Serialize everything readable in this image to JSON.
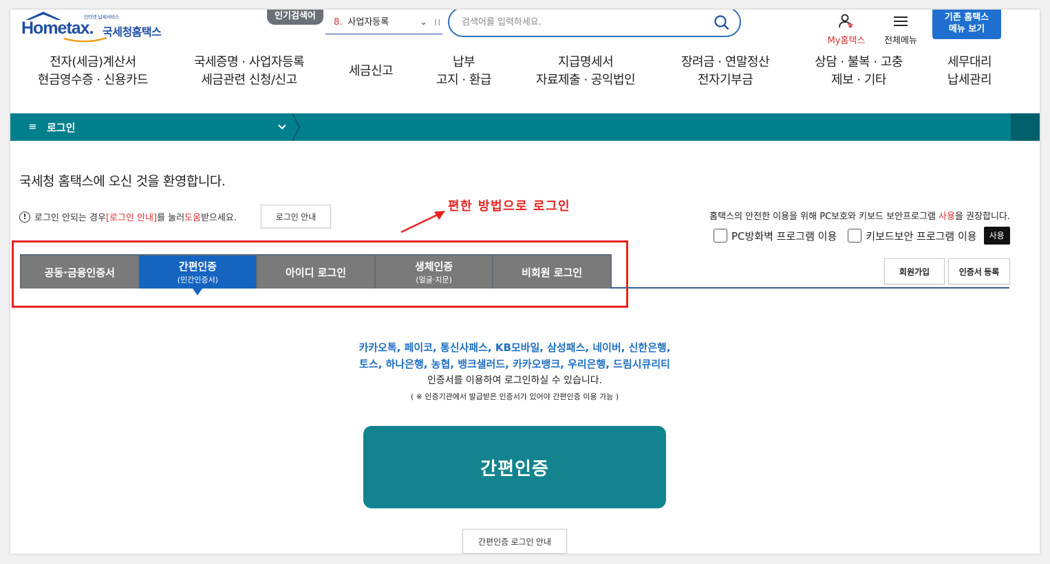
{
  "header": {
    "logo_small": "인터넷 납세서비스",
    "logo_word": "Hometax.",
    "logo_ko": "국세청홈택스",
    "popular_tag": "인기검색어",
    "popular_num": "8.",
    "popular_text": "사업자등록",
    "search_placeholder": "검색어를 입력하세요.",
    "my_hometax": "My홈택스",
    "all_menu": "전체메뉴",
    "old_hometax_line1": "기존 홈택스",
    "old_hometax_line2": "메뉴 보기"
  },
  "gnb": [
    "전자(세금)계산서\n현금영수증 · 신용카드",
    "국세증명 · 사업자등록\n세금관련 신청/신고",
    "세금신고",
    "납부\n고지 · 환급",
    "지급명세서\n자료제출 · 공익법인",
    "장려금 · 연말정산\n전자기부금",
    "상담 · 불복 · 고충\n제보 · 기타",
    "세무대리\n납세관리"
  ],
  "bar": {
    "title": "로그인"
  },
  "welcome": "국세청 홈택스에 오신 것을 환영합니다.",
  "notice": {
    "prefix": "로그인 안되는 경우 ",
    "link": "[로그인 안내]",
    "middle": "를 눌러 ",
    "help": "도움",
    "suffix": "받으세요.",
    "button": "로그인 안내"
  },
  "annotation": "편한 방법으로 로그인",
  "security": {
    "text_prefix": "홈택스의 안전한 이용을 위해 PC보호와 키보드 보안프로그램 ",
    "text_red": "사용",
    "text_suffix": "을 권장합니다.",
    "pc_firewall": "PC방화벽 프로그램 이용",
    "keyboard": "키보드보안 프로그램 이용",
    "use_button": "사용"
  },
  "tabs": [
    {
      "label": "공동·금융인증서",
      "sub": ""
    },
    {
      "label": "간편인증",
      "sub": "(민간인증서)"
    },
    {
      "label": "아이디 로그인",
      "sub": ""
    },
    {
      "label": "생체인증",
      "sub": "(얼굴·지문)"
    },
    {
      "label": "비회원 로그인",
      "sub": ""
    }
  ],
  "buttons": {
    "join": "회원가입",
    "cert_register": "인증서 등록"
  },
  "info": {
    "providers_line1": "카카오톡, 페이코, 통신사패스, KB모바일, 삼성패스, 네이버, 신한은행,",
    "providers_line2": "토스, 하나은행, 농협, 뱅크샐러드, 카카오뱅크, 우리은행, 드림시큐리티",
    "desc": "인증서를 이용하여 로그인하실 수 있습니다.",
    "note": "( ※ 인증기관에서 발급받은 인증서가 있어야 간편인증 이용 가능 )"
  },
  "main_button": "간편인증",
  "simple_guide": "간편인증 로그인 안내",
  "colors": {
    "brand_blue": "#1e4fa3",
    "teal": "#007f8c",
    "tab_active": "#1564c0",
    "annotation_red": "#e8231f"
  }
}
